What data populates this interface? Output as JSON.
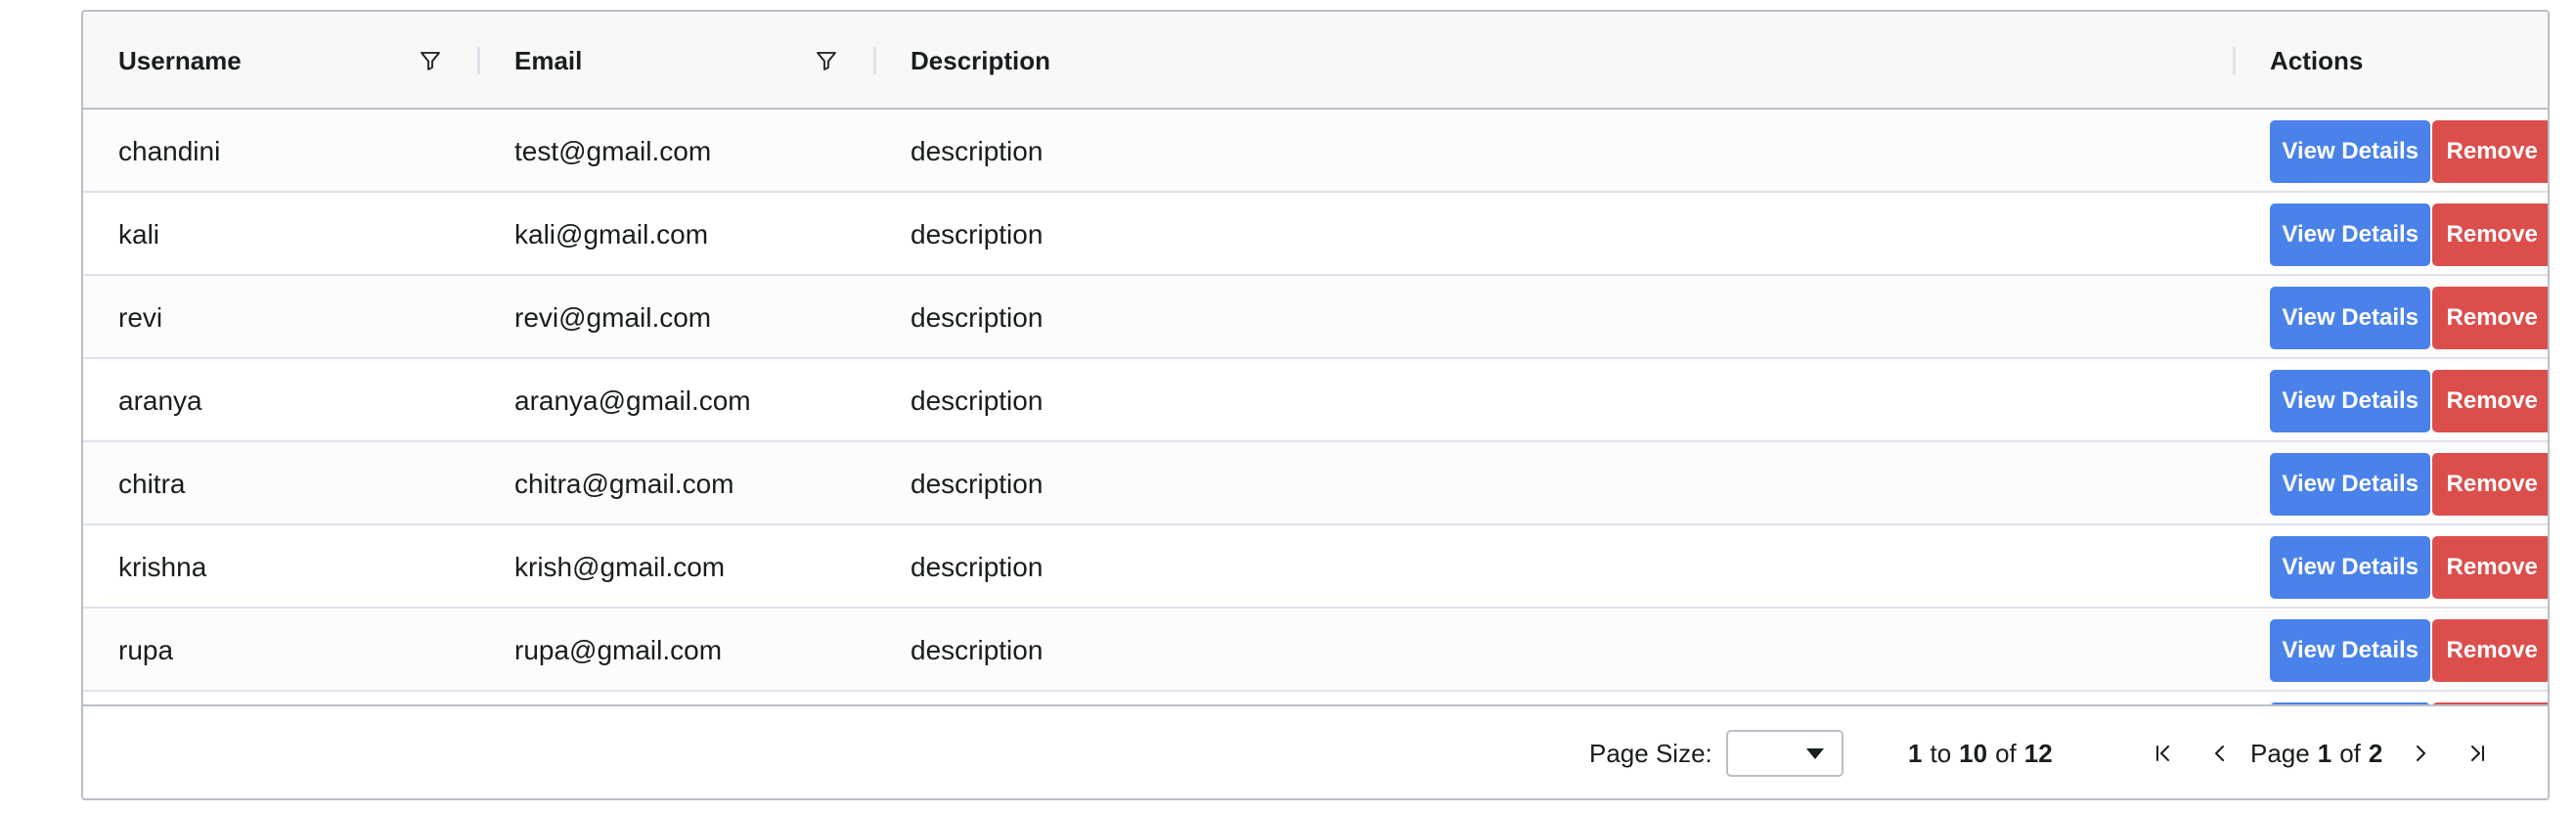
{
  "columns": {
    "username": "Username",
    "email": "Email",
    "description": "Description",
    "actions": "Actions"
  },
  "rows": [
    {
      "username": "chandini",
      "email": "test@gmail.com",
      "description": "description"
    },
    {
      "username": "kali",
      "email": "kali@gmail.com",
      "description": "description"
    },
    {
      "username": "revi",
      "email": "revi@gmail.com",
      "description": "description"
    },
    {
      "username": "aranya",
      "email": "aranya@gmail.com",
      "description": "description"
    },
    {
      "username": "chitra",
      "email": "chitra@gmail.com",
      "description": "description"
    },
    {
      "username": "krishna",
      "email": "krish@gmail.com",
      "description": "description"
    },
    {
      "username": "rupa",
      "email": "rupa@gmail.com",
      "description": "description"
    }
  ],
  "actions": {
    "view_label": "View Details",
    "remove_label": "Remove"
  },
  "pagination": {
    "page_size_label": "Page Size:",
    "page_size_value": "",
    "range_start": "1",
    "range_to": "to",
    "range_end": "10",
    "range_of": "of",
    "total": "12",
    "page_label": "Page",
    "current_page": "1",
    "page_of": "of",
    "total_pages": "2"
  },
  "icons": {
    "filter": "filter-icon",
    "first": "first-page-icon",
    "prev": "previous-page-icon",
    "next": "next-page-icon",
    "last": "last-page-icon",
    "dropdown": "dropdown-caret-icon"
  },
  "colors": {
    "view_button": "#4a82ea",
    "remove_button": "#dc4e4c",
    "header_bg": "#f8f8f8",
    "border": "#babfc7"
  }
}
